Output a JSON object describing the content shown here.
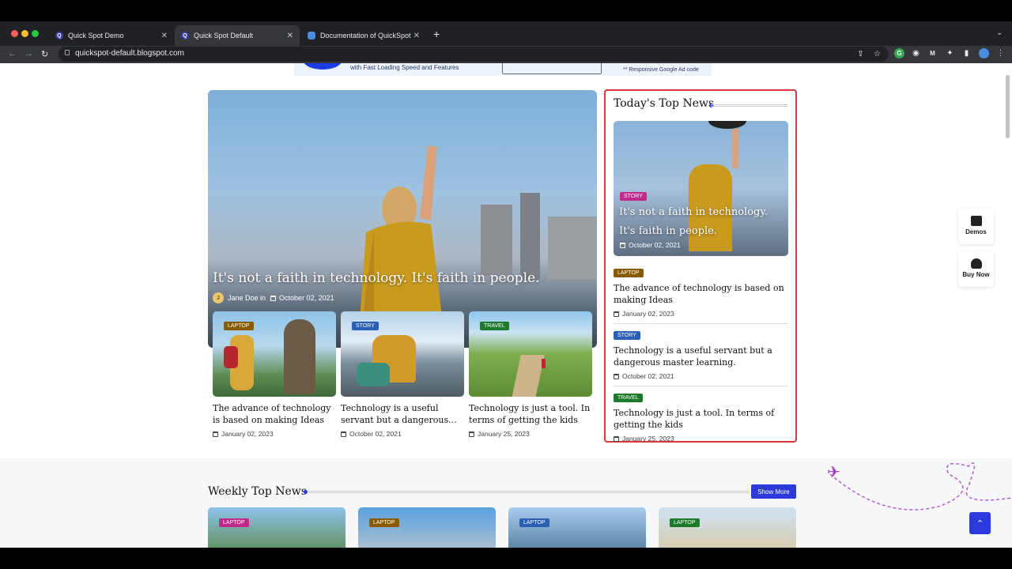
{
  "browser": {
    "tabs": [
      {
        "label": "Quick Spot Demo",
        "icon": "q-favicon"
      },
      {
        "label": "Quick Spot Default",
        "icon": "q-favicon"
      },
      {
        "label": "Documentation of QuickSpot",
        "icon": "doc-favicon"
      }
    ],
    "active_tab": 1,
    "url": "quickspot-default.blogspot.com"
  },
  "ad": {
    "line1": "with Fast Loading Speed and Features",
    "line2": "** Responsive Google Ad code"
  },
  "hero": {
    "title": "It's not a faith in technology. It's faith in people.",
    "author": "Jane Doe in",
    "date": "October 02, 2021"
  },
  "mini_cards": [
    {
      "tag": "LAPTOP",
      "title": "The advance of technology is based on making Ideas",
      "date": "January 02, 2023"
    },
    {
      "tag": "STORY",
      "title": "Technology is a useful servant but a dangerous...",
      "date": "October 02, 2021"
    },
    {
      "tag": "TRAVEL",
      "title": "Technology is just a tool. In terms of getting the kids",
      "date": "January 25, 2023"
    }
  ],
  "sidebar": {
    "title": "Today's Top News",
    "feature": {
      "tag": "STORY",
      "title": "It's not a faith in technology. It's faith in people.",
      "date": "October 02, 2021"
    },
    "items": [
      {
        "tag": "LAPTOP",
        "title": "The advance of technology is based on making Ideas",
        "date": "January 02, 2023"
      },
      {
        "tag": "STORY",
        "title": "Technology is a useful servant but a dangerous master learning.",
        "date": "October 02, 2021"
      },
      {
        "tag": "TRAVEL",
        "title": "Technology is just a tool. In terms of getting the kids",
        "date": "January 25, 2023"
      }
    ]
  },
  "floating": {
    "demos": "Demos",
    "buy": "Buy Now"
  },
  "weekly": {
    "title": "Weekly Top News",
    "show_more": "Show More",
    "cards": [
      {
        "tag": "LAPTOP"
      },
      {
        "tag": "LAPTOP"
      },
      {
        "tag": "LAPTOP"
      },
      {
        "tag": "LAPTOP"
      }
    ]
  },
  "colors": {
    "accent": "#2d3adb",
    "sidebar_border": "#d9363e"
  }
}
